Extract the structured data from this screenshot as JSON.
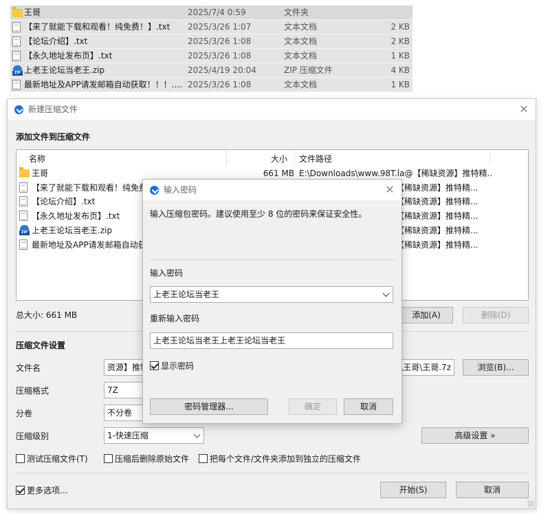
{
  "explorer": {
    "rows": [
      {
        "icon": "folder-icon",
        "name": "王哥",
        "date": "2025/7/4 0:59",
        "type": "文件夹",
        "size": ""
      },
      {
        "icon": "text-file-icon",
        "name": "【来了就能下载和观看！纯免费！】.txt",
        "date": "2025/3/26 1:07",
        "type": "文本文档",
        "size": "2 KB"
      },
      {
        "icon": "text-file-icon",
        "name": "【论坛介绍】.txt",
        "date": "2025/3/26 1:08",
        "type": "文本文档",
        "size": "2 KB"
      },
      {
        "icon": "text-file-icon",
        "name": "【永久地址发布页】.txt",
        "date": "2025/3/26 1:08",
        "type": "文本文档",
        "size": "1 KB"
      },
      {
        "icon": "zip-file-icon",
        "name": "上老王论坛当老王.zip",
        "date": "2025/4/19 20:04",
        "type": "ZIP 压缩文件",
        "size": "4 KB"
      },
      {
        "icon": "text-file-icon",
        "name": "最新地址及APP请发邮箱自动获取！！！....",
        "date": "2025/3/26 1:08",
        "type": "文本文档",
        "size": "1 KB"
      }
    ]
  },
  "main_dialog": {
    "title": "新建压缩文件",
    "add_files_heading": "添加文件到压缩文件",
    "columns": {
      "name": "名称",
      "size": "大小",
      "path": "文件路径"
    },
    "files": [
      {
        "icon": "folder-icon",
        "name": "王哥",
        "size": "661 MB",
        "path": "E:\\Downloads\\www.98T.la@【稀缺资源】推特精..."
      },
      {
        "icon": "text-file-icon",
        "name": "【来了就能下载和观看！纯免费",
        "size": "",
        "path": "【稀缺资源】推特精..."
      },
      {
        "icon": "text-file-icon",
        "name": "【论坛介绍】.txt",
        "size": "",
        "path": "【稀缺资源】推特精..."
      },
      {
        "icon": "text-file-icon",
        "name": "【永久地址发布页】.txt",
        "size": "",
        "path": "【稀缺资源】推特精..."
      },
      {
        "icon": "zip-file-icon",
        "name": "上老王论坛当老王.zip",
        "size": "",
        "path": "【稀缺资源】推特精..."
      },
      {
        "icon": "text-file-icon",
        "name": "最新地址及APP请发邮箱自动获取",
        "size": "",
        "path": "【稀缺资源】推特精..."
      }
    ],
    "total_size": "总大小: 661 MB",
    "add_button": "添加(A)",
    "delete_button": "删除(D)",
    "settings_heading": "压缩文件设置",
    "filename_label": "文件名",
    "filename_value_left": "资源】推特",
    "filename_value_right": "\\王哥\\王哥.7z",
    "browse_button": "浏览(B)...",
    "format_label": "压缩格式",
    "format_value": "7Z",
    "volume_label": "分卷",
    "volume_value": "不分卷",
    "level_label": "压缩级别",
    "level_value": "1-快速压缩",
    "advanced_button": "高级设置 »",
    "test_checkbox": "测试压缩文件(T)",
    "delete_after_checkbox": "压缩后删除原始文件",
    "separate_checkbox": "把每个文件/文件夹添加到独立的压缩文件",
    "more_options_checkbox": "更多选项...",
    "start_button": "开始(S)",
    "cancel_button": "取消"
  },
  "password_dialog": {
    "title": "输入密码",
    "description": "输入压缩包密码。建议使用至少 8 位的密码来保证安全性。",
    "password_label": "输入密码",
    "password_value": "上老王论坛当老王",
    "confirm_label": "重新输入密码",
    "confirm_value": "上老王论坛当老王上老王论坛当老王",
    "show_password_checkbox": "显示密码",
    "show_password_checked": true,
    "password_manager_button": "密码管理器...",
    "ok_button": "确定",
    "cancel_button": "取消"
  },
  "colors": {
    "accent": "#1e6fd9",
    "dialog_bg": "#f0f0f0",
    "explorer_row_bg": "#e4e4e4"
  }
}
